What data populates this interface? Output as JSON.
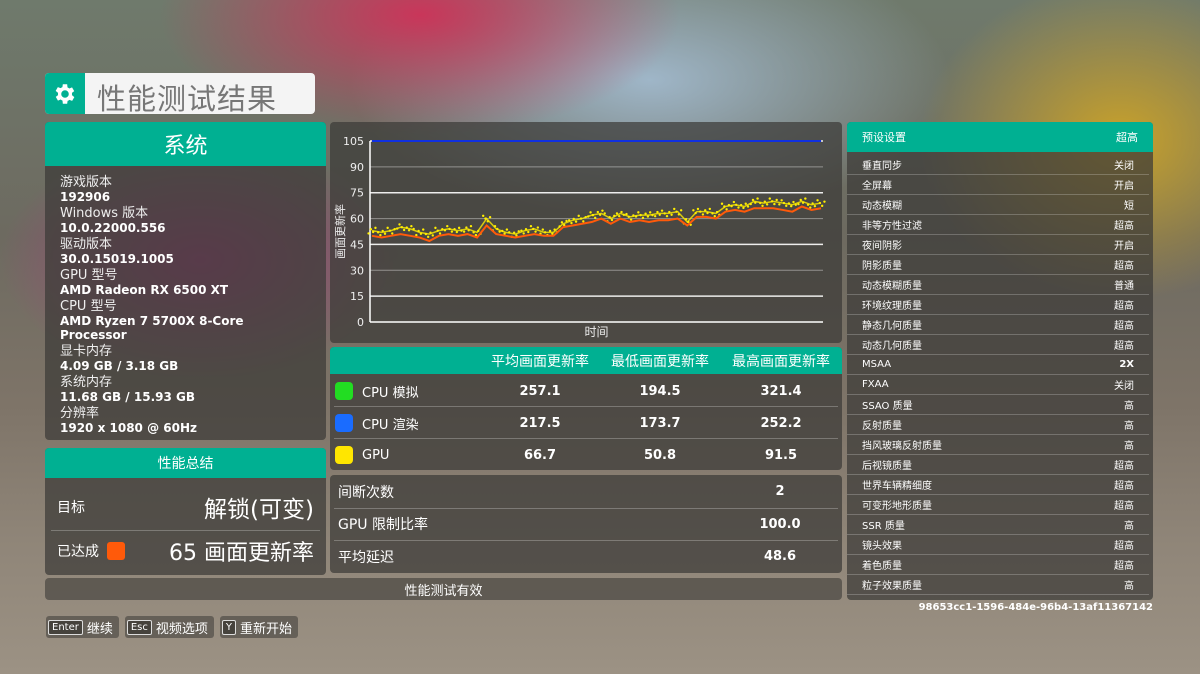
{
  "header": {
    "title": "性能测试结果",
    "icon": "gear-icon"
  },
  "system": {
    "title": "系统",
    "items": [
      {
        "label": "游戏版本",
        "value": "192906"
      },
      {
        "label": "Windows 版本",
        "value": "10.0.22000.556"
      },
      {
        "label": "驱动版本",
        "value": "30.0.15019.1005"
      },
      {
        "label": "GPU 型号",
        "value": "AMD Radeon RX 6500 XT"
      },
      {
        "label": "CPU 型号",
        "value": "AMD Ryzen 7 5700X 8-Core Processor"
      },
      {
        "label": "显卡内存",
        "value": "4.09 GB / 3.18 GB"
      },
      {
        "label": "系统内存",
        "value": "11.68 GB / 15.93 GB"
      },
      {
        "label": "分辨率",
        "value": "1920 x 1080 @ 60Hz"
      }
    ]
  },
  "summary": {
    "title": "性能总结",
    "target_label": "目标",
    "target_value": "解锁(可变)",
    "achieved_label": "已达成",
    "achieved_value": "65 画面更新率",
    "achieved_color": "#ff5a0a"
  },
  "chart_data": {
    "type": "line",
    "xlabel": "时间",
    "ylabel": "画面更新率",
    "ylim": [
      0,
      105
    ],
    "yticks": [
      "0",
      "15",
      "30",
      "45",
      "60",
      "75",
      "90",
      "105"
    ],
    "grid": true,
    "series": [
      {
        "color": "#1030e0",
        "values": [
          105,
          105
        ]
      },
      {
        "color": "#ffee00",
        "style": "scatter",
        "values": [
          53,
          52,
          53,
          55,
          54,
          52,
          51,
          53,
          54,
          53,
          54,
          52,
          60,
          54,
          52,
          51,
          53,
          54,
          52,
          52,
          57,
          59,
          60,
          62,
          63,
          60,
          63,
          61,
          62,
          62,
          63,
          63,
          64,
          58,
          64,
          64,
          63,
          67,
          68,
          67,
          70,
          69,
          70,
          69,
          68,
          70,
          68,
          69
        ]
      },
      {
        "color": "#ff5a0a",
        "values": [
          50,
          49,
          50,
          51,
          50,
          49,
          47,
          50,
          51,
          50,
          51,
          49,
          56,
          51,
          50,
          49,
          50,
          51,
          50,
          50,
          55,
          56,
          57,
          58,
          60,
          57,
          60,
          58,
          59,
          58,
          59,
          59,
          60,
          56,
          61,
          61,
          60,
          64,
          65,
          64,
          66,
          66,
          66,
          65,
          64,
          67,
          65,
          66
        ]
      }
    ]
  },
  "fps_table": {
    "headers": [
      "平均画面更新率",
      "最低画面更新率",
      "最高画面更新率"
    ],
    "rows": [
      {
        "name": "CPU 模拟",
        "color": "#22dd22",
        "avg": "257.1",
        "min": "194.5",
        "max": "321.4"
      },
      {
        "name": "CPU 渲染",
        "color": "#1a6cff",
        "avg": "217.5",
        "min": "173.7",
        "max": "252.2"
      },
      {
        "name": "GPU",
        "color": "#ffe600",
        "avg": "66.7",
        "min": "50.8",
        "max": "91.5"
      }
    ]
  },
  "stats": [
    {
      "label": "间断次数",
      "value": "2"
    },
    {
      "label": "GPU 限制比率",
      "value": "100.0"
    },
    {
      "label": "平均延迟",
      "value": "48.6"
    }
  ],
  "valid_text": "性能测试有效",
  "settings": {
    "preset_label": "预设设置",
    "preset_value": "超高",
    "items": [
      {
        "label": "垂直同步",
        "value": "关闭"
      },
      {
        "label": "全屏幕",
        "value": "开启"
      },
      {
        "label": "动态模糊",
        "value": "短"
      },
      {
        "label": "非等方性过滤",
        "value": "超高"
      },
      {
        "label": "夜间阴影",
        "value": "开启"
      },
      {
        "label": "阴影质量",
        "value": "超高"
      },
      {
        "label": "动态模糊质量",
        "value": "普通"
      },
      {
        "label": "环境纹理质量",
        "value": "超高"
      },
      {
        "label": "静态几何质量",
        "value": "超高"
      },
      {
        "label": "动态几何质量",
        "value": "超高"
      },
      {
        "label": "MSAA",
        "value": "2X"
      },
      {
        "label": "FXAA",
        "value": "关闭"
      },
      {
        "label": "SSAO 质量",
        "value": "高"
      },
      {
        "label": "反射质量",
        "value": "高"
      },
      {
        "label": "挡风玻璃反射质量",
        "value": "高"
      },
      {
        "label": "后视镜质量",
        "value": "超高"
      },
      {
        "label": "世界车辆精细度",
        "value": "超高"
      },
      {
        "label": "可变形地形质量",
        "value": "超高"
      },
      {
        "label": "SSR 质量",
        "value": "高"
      },
      {
        "label": "镜头效果",
        "value": "超高"
      },
      {
        "label": "着色质量",
        "value": "超高"
      },
      {
        "label": "粒子效果质量",
        "value": "高"
      }
    ]
  },
  "session_id": "98653cc1-1596-484e-96b4-13af11367142",
  "footer": [
    {
      "key": "Enter",
      "label": "继续"
    },
    {
      "key": "Esc",
      "label": "视频选项"
    },
    {
      "key": "Y",
      "label": "重新开始"
    }
  ]
}
